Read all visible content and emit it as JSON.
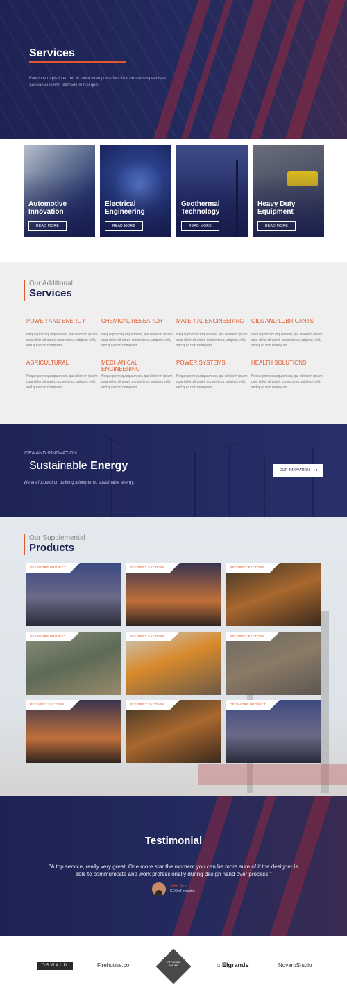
{
  "hero": {
    "title": "Services",
    "description": "Faucibus turpis in eu mi. At tortor vitae purus faucibus ornare suspendisse. Aenean euismod elementum nisi quis."
  },
  "service_cards": [
    {
      "title": "Automotive Innovation",
      "button": "READ MORE"
    },
    {
      "title": "Electrical Engineering",
      "button": "READ MORE"
    },
    {
      "title": "Geothermal Technology",
      "button": "READ MORE"
    },
    {
      "title": "Heavy Duty Equipment",
      "button": "READ MORE"
    }
  ],
  "additional": {
    "subtitle": "Our Additional",
    "title": "Services",
    "items": [
      {
        "title": "POWER AND ENERGY",
        "text": "Neque porro quisquam est, qui dolorem ipsum quia dolor sit amet, consectetur, adipisci velit, sed quia non numquam."
      },
      {
        "title": "CHEMICAL RESEARCH",
        "text": "Neque porro quisquam est, qui dolorem ipsum quia dolor sit amet, consectetur, adipisci velit, sed quia non numquam."
      },
      {
        "title": "MATERIAL ENGINEERING",
        "text": "Neque porro quisquam est, qui dolorem ipsum quia dolor sit amet, consectetur, adipisci velit, sed quia non numquam."
      },
      {
        "title": "OILS AND LUBRICANTS",
        "text": "Neque porro quisquam est, qui dolorem ipsum quia dolor sit amet, consectetur, adipisci velit, sed quia non numquam."
      },
      {
        "title": "AGRICULTURAL",
        "text": "Neque porro quisquam est, qui dolorem ipsum quia dolor sit amet, consectetur, adipisci velit, sed quia non numquam."
      },
      {
        "title": "MECHANICAL ENGINEERING",
        "text": "Neque porro quisquam est, qui dolorem ipsum quia dolor sit amet, consectetur, adipisci velit, sed quia non numquam."
      },
      {
        "title": "POWER SYSTEMS",
        "text": "Neque porro quisquam est, qui dolorem ipsum quia dolor sit amet, consectetur, adipisci velit, sed quia non numquam."
      },
      {
        "title": "HEALTH SOLUTIONS",
        "text": "Neque porro quisquam est, qui dolorem ipsum quia dolor sit amet, consectetur, adipisci velit, sed quia non numquam."
      }
    ]
  },
  "energy": {
    "eyebrow": "IDEA AND INNOVATION",
    "title_light": "Sustainable",
    "title_bold": "Energy",
    "description": "We are focused on building a long-term, sustainable energy.",
    "button": "OUR INNOVATION"
  },
  "products": {
    "subtitle": "Our Supplemental",
    "title": "Products",
    "items": [
      {
        "tag": "OFFSHORE PROJECT"
      },
      {
        "tag": "REFINERY FACTORY"
      },
      {
        "tag": "REFINERY FACTORY"
      },
      {
        "tag": "OFFSHORE PROJECT"
      },
      {
        "tag": "REFINERY FACTORY"
      },
      {
        "tag": "REFINERY FACTORY"
      },
      {
        "tag": "REFINERY FACTORY"
      },
      {
        "tag": "REFINERY FACTORY"
      },
      {
        "tag": "OFFSHORE PROJECT"
      }
    ]
  },
  "testimonial": {
    "title": "Testimonial",
    "quote": "\"A top service, really very great. One more star the moment you can be more sure of if the designer is able to communicate and work professionally during design hand over process.\"",
    "name": "John Doe",
    "role": "CEO of Industro"
  },
  "logos": [
    "OSWALD",
    "Firehouse.co",
    "At Aurora House",
    "Elgrande",
    "NovaroStudio"
  ],
  "colors": {
    "accent": "#e1572c",
    "navy": "#1d2352",
    "light_bg": "#efefef"
  }
}
